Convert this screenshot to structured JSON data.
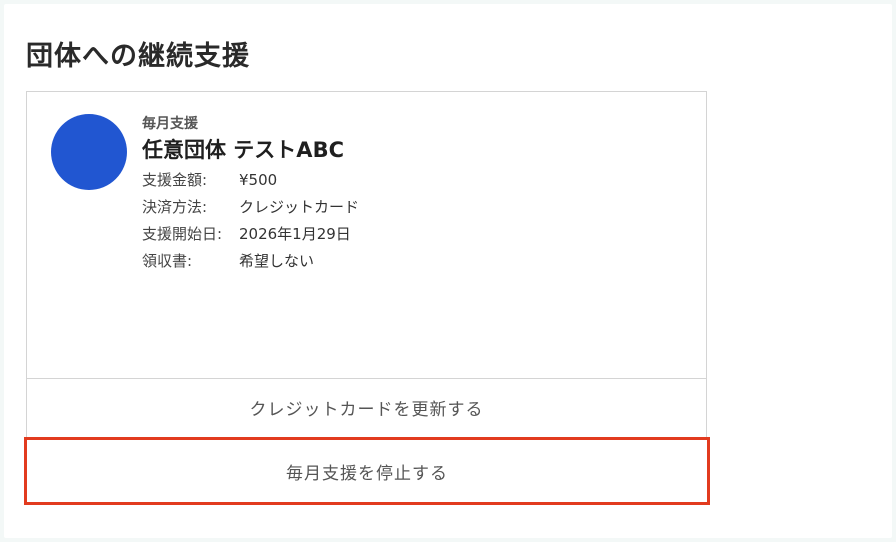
{
  "section": {
    "title": "団体への継続支援"
  },
  "subscription": {
    "kind": "毎月支援",
    "organization_name": "任意団体 テストABC",
    "avatar_color": "#2156d1",
    "details": [
      {
        "label": "支援金額:",
        "value": "¥500"
      },
      {
        "label": "決済方法:",
        "value": "クレジットカード"
      },
      {
        "label": "支援開始日:",
        "value": "2026年1月29日"
      },
      {
        "label": "領収書:",
        "value": "希望しない"
      }
    ]
  },
  "actions": {
    "update_card_label": "クレジットカードを更新する",
    "stop_support_label": "毎月支援を停止する",
    "highlight_color": "#e23b1f"
  }
}
